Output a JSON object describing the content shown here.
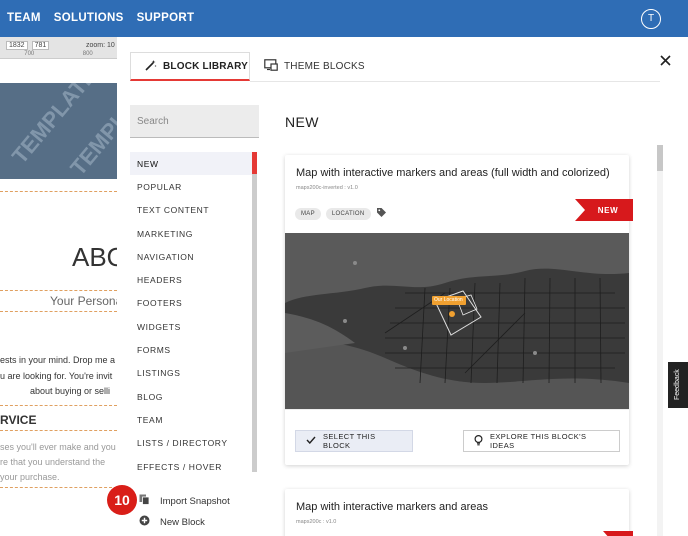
{
  "topnav": {
    "items": [
      "TEAM",
      "SOLUTIONS",
      "SUPPORT"
    ],
    "avatar_letter": "T"
  },
  "editor": {
    "width_value": "1832",
    "height_value": "781",
    "zoom_label": "zoom: 10",
    "ruler_marks": [
      "700",
      "800"
    ],
    "watermark_1": "TEMPLATE",
    "watermark_2": "TEMPL",
    "heading": "ABO",
    "subheading": "Your Personal",
    "para_1": "ests in your mind. Drop me a",
    "para_2": "u are looking for. You're invit",
    "para_3": "about buying or selli",
    "service_heading": "RVICE",
    "para_4": "ses you'll ever make and you",
    "para_5": "re that you understand the",
    "para_6": "your purchase."
  },
  "modal": {
    "tab_block_library": "BLOCK LIBRARY",
    "tab_theme_blocks": "THEME BLOCKS",
    "search_placeholder": "Search",
    "categories": [
      "NEW",
      "POPULAR",
      "TEXT CONTENT",
      "MARKETING",
      "NAVIGATION",
      "HEADERS",
      "FOOTERS",
      "WIDGETS",
      "FORMS",
      "LISTINGS",
      "BLOG",
      "TEAM",
      "LISTS / DIRECTORY",
      "EFFECTS / HOVER"
    ],
    "active_category": "NEW",
    "import_snapshot": "Import Snapshot",
    "new_block": "New Block",
    "step_badge": "10",
    "section_title": "NEW",
    "cards": [
      {
        "title": "Map with interactive markers and areas (full width and colorized)",
        "subtitle": "maps200c-inverted : v1.0",
        "tags": [
          "MAP",
          "LOCATION"
        ],
        "ribbon": "NEW",
        "map_pin_label": "Our Location",
        "select_label": "SELECT THIS BLOCK",
        "explore_label": "EXPLORE THIS BLOCK'S IDEAS"
      },
      {
        "title": "Map with interactive markers and areas",
        "subtitle": "maps200c : v1.0"
      }
    ]
  },
  "feedback_label": "Feedback",
  "colors": {
    "topbar": "#2f6db5",
    "accent": "#e53935",
    "ribbon": "#d7191c",
    "map_bg": "#3a3a3a"
  }
}
